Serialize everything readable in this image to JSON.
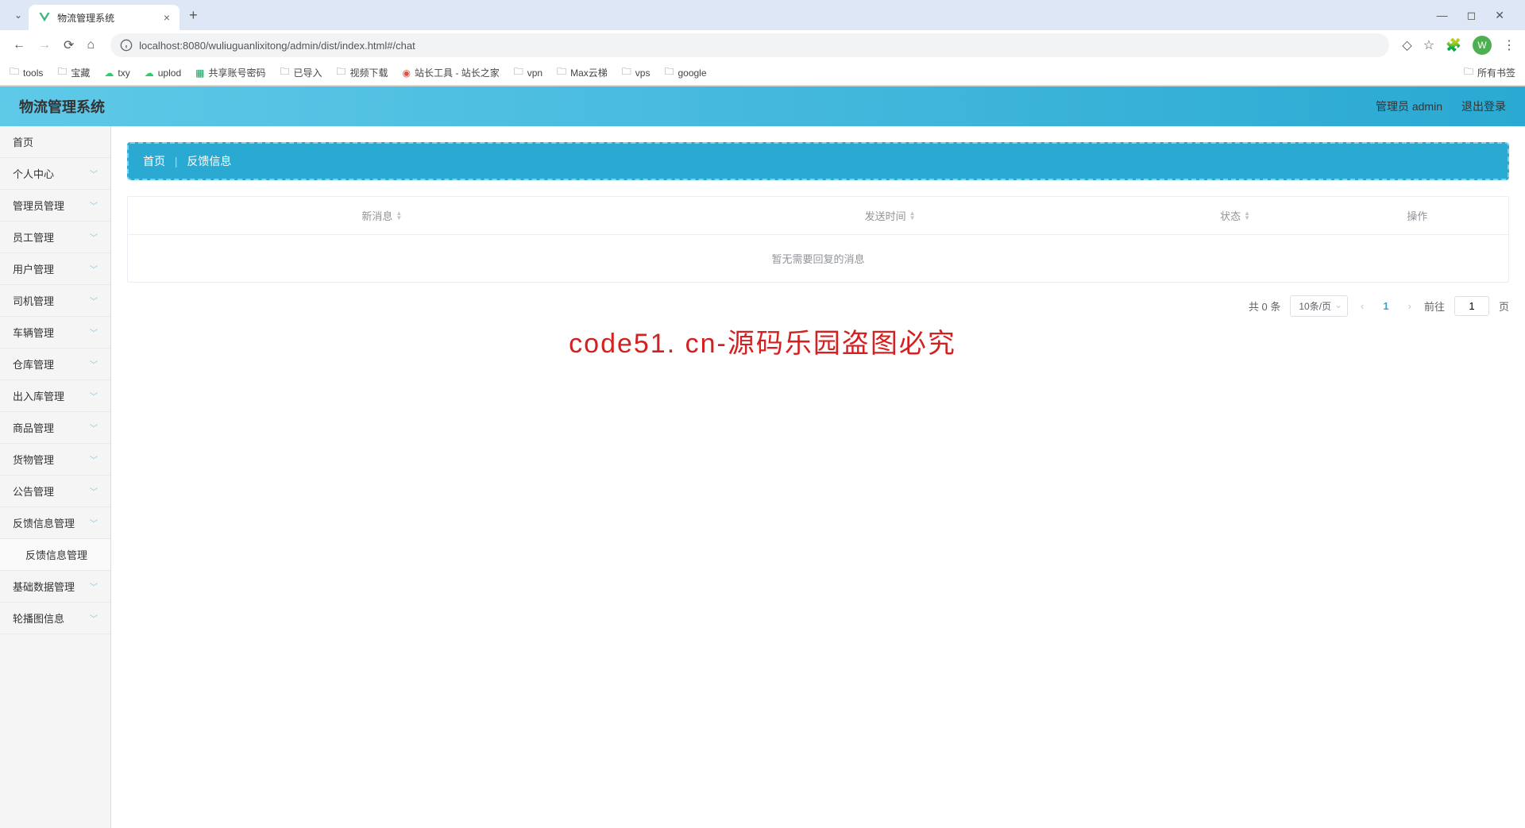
{
  "browser": {
    "tab_title": "物流管理系统",
    "url": "localhost:8080/wuliuguanlixitong/admin/dist/index.html#/chat",
    "avatar_letter": "W",
    "bookmarks": [
      "tools",
      "宝藏",
      "txy",
      "uplod",
      "共享账号密码",
      "已导入",
      "视频下载",
      "站长工具 - 站长之家",
      "vpn",
      "Max云梯",
      "vps",
      "google"
    ],
    "all_bookmarks": "所有书签"
  },
  "header": {
    "app_title": "物流管理系统",
    "user_info": "管理员 admin",
    "logout": "退出登录"
  },
  "sidebar": {
    "items": [
      {
        "label": "首页",
        "expandable": false
      },
      {
        "label": "个人中心",
        "expandable": true
      },
      {
        "label": "管理员管理",
        "expandable": true
      },
      {
        "label": "员工管理",
        "expandable": true
      },
      {
        "label": "用户管理",
        "expandable": true
      },
      {
        "label": "司机管理",
        "expandable": true
      },
      {
        "label": "车辆管理",
        "expandable": true
      },
      {
        "label": "仓库管理",
        "expandable": true
      },
      {
        "label": "出入库管理",
        "expandable": true
      },
      {
        "label": "商品管理",
        "expandable": true
      },
      {
        "label": "货物管理",
        "expandable": true
      },
      {
        "label": "公告管理",
        "expandable": true
      },
      {
        "label": "反馈信息管理",
        "expandable": true
      },
      {
        "label": "反馈信息管理",
        "sub": true
      },
      {
        "label": "基础数据管理",
        "expandable": true
      },
      {
        "label": "轮播图信息",
        "expandable": true
      }
    ]
  },
  "breadcrumb": {
    "home": "首页",
    "current": "反馈信息"
  },
  "table": {
    "columns": [
      "新消息",
      "发送时间",
      "状态",
      "操作"
    ],
    "empty_text": "暂无需要回复的消息"
  },
  "pagination": {
    "total_text": "共 0 条",
    "page_size": "10条/页",
    "current": "1",
    "goto_prefix": "前往",
    "goto_value": "1",
    "goto_suffix": "页"
  },
  "watermark": "code51. cn-源码乐园盗图必究"
}
